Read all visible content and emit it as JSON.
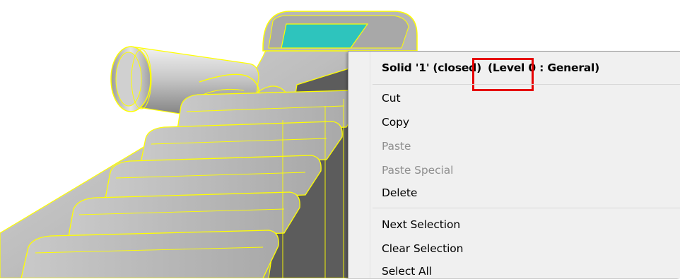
{
  "context_menu": {
    "header": {
      "solid": "Solid '1'",
      "state": "(closed)",
      "level": "(Level 0 : General)"
    },
    "items": [
      {
        "label": "Cut",
        "enabled": true
      },
      {
        "label": "Copy",
        "enabled": true
      },
      {
        "label": "Paste",
        "enabled": false
      },
      {
        "label": "Paste Special",
        "enabled": false
      },
      {
        "label": "Delete",
        "enabled": true
      },
      {
        "label": "Next Selection",
        "enabled": true
      },
      {
        "label": "Clear Selection",
        "enabled": true
      },
      {
        "label": "Select All",
        "enabled": true
      }
    ]
  },
  "colors": {
    "edge_highlight": "#ffff00",
    "face_selected": "#2ec4bd",
    "annotation_box": "#e60000",
    "disabled_text": "#8f8f8f"
  }
}
